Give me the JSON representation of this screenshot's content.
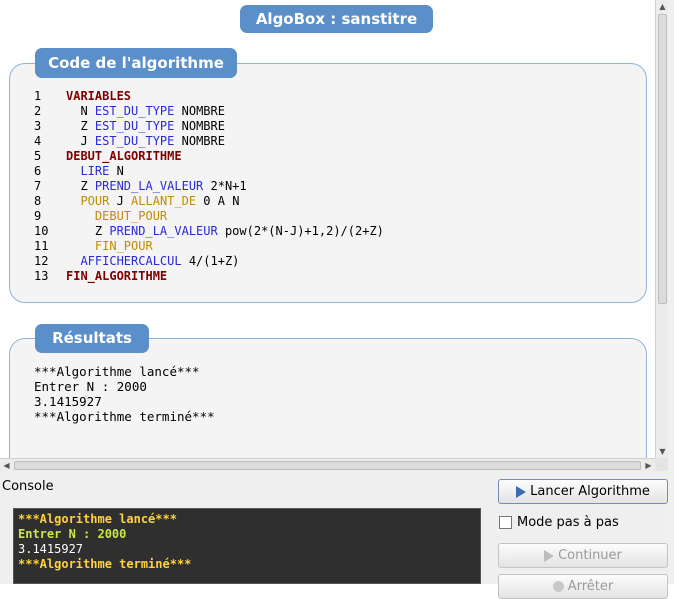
{
  "window": {
    "title": "AlgoBox : sanstitre"
  },
  "code_section": {
    "title": "Code de l'algorithme",
    "lines": [
      {
        "n": "1",
        "indent": "",
        "parts": [
          {
            "t": "VARIABLES",
            "c": "var"
          }
        ]
      },
      {
        "n": "2",
        "indent": "  ",
        "parts": [
          {
            "t": "N ",
            "c": "plain"
          },
          {
            "t": "EST_DU_TYPE",
            "c": "blue"
          },
          {
            "t": " NOMBRE",
            "c": "plain"
          }
        ]
      },
      {
        "n": "3",
        "indent": "  ",
        "parts": [
          {
            "t": "Z ",
            "c": "plain"
          },
          {
            "t": "EST_DU_TYPE",
            "c": "blue"
          },
          {
            "t": " NOMBRE",
            "c": "plain"
          }
        ]
      },
      {
        "n": "4",
        "indent": "  ",
        "parts": [
          {
            "t": "J ",
            "c": "plain"
          },
          {
            "t": "EST_DU_TYPE",
            "c": "blue"
          },
          {
            "t": " NOMBRE",
            "c": "plain"
          }
        ]
      },
      {
        "n": "5",
        "indent": "",
        "parts": [
          {
            "t": "DEBUT_ALGORITHME",
            "c": "var"
          }
        ]
      },
      {
        "n": "6",
        "indent": "  ",
        "parts": [
          {
            "t": "LIRE",
            "c": "blue"
          },
          {
            "t": " N",
            "c": "plain"
          }
        ]
      },
      {
        "n": "7",
        "indent": "  ",
        "parts": [
          {
            "t": "Z ",
            "c": "plain"
          },
          {
            "t": "PREND_LA_VALEUR",
            "c": "blue"
          },
          {
            "t": " 2*N+1",
            "c": "plain"
          }
        ]
      },
      {
        "n": "8",
        "indent": "  ",
        "parts": [
          {
            "t": "POUR",
            "c": "gold"
          },
          {
            "t": " J ",
            "c": "plain"
          },
          {
            "t": "ALLANT_DE",
            "c": "gold"
          },
          {
            "t": " 0 A N",
            "c": "plain"
          }
        ]
      },
      {
        "n": "9",
        "indent": "    ",
        "parts": [
          {
            "t": "DEBUT_POUR",
            "c": "gold"
          }
        ]
      },
      {
        "n": "10",
        "indent": "    ",
        "parts": [
          {
            "t": "Z ",
            "c": "plain"
          },
          {
            "t": "PREND_LA_VALEUR",
            "c": "blue"
          },
          {
            "t": " pow(2*(N-J)+1,2)/(2+Z)",
            "c": "plain"
          }
        ]
      },
      {
        "n": "11",
        "indent": "    ",
        "parts": [
          {
            "t": "FIN_POUR",
            "c": "gold"
          }
        ]
      },
      {
        "n": "12",
        "indent": "  ",
        "parts": [
          {
            "t": "AFFICHERCALCUL",
            "c": "blue"
          },
          {
            "t": " 4/(1+Z)",
            "c": "plain"
          }
        ]
      },
      {
        "n": "13",
        "indent": "",
        "parts": [
          {
            "t": "FIN_ALGORITHME",
            "c": "var"
          }
        ]
      }
    ]
  },
  "results_section": {
    "title": "Résultats",
    "lines": [
      "***Algorithme lancé***",
      "Entrer N : 2000",
      "3.1415927",
      "***Algorithme terminé***"
    ]
  },
  "console": {
    "label": "Console",
    "lines": [
      {
        "text": "***Algorithme lancé***",
        "style": "yellow"
      },
      {
        "text": "Entrer N : 2000",
        "style": "green"
      },
      {
        "text": "3.1415927",
        "style": "white"
      },
      {
        "text": "***Algorithme terminé***",
        "style": "yellow"
      }
    ]
  },
  "controls": {
    "run_label": "Lancer Algorithme",
    "step_label": "Mode pas à pas",
    "step_checked": false,
    "continue_label": "Continuer",
    "stop_label": "Arrêter"
  },
  "colors": {
    "accent": "#5b8fc9",
    "panel_border": "#8fb3d9",
    "keyword_var": "#800000",
    "keyword_blue": "#2a2ad6",
    "keyword_gold": "#c08c00",
    "console_bg": "#2f2f2f"
  }
}
